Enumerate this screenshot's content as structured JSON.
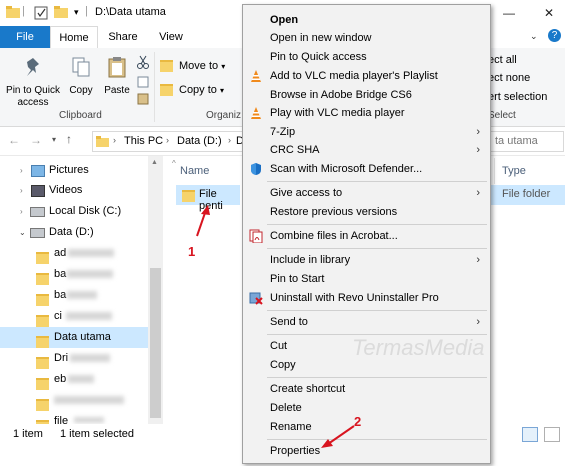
{
  "window": {
    "path": "D:\\Data utama"
  },
  "ribbon": {
    "tabs": [
      {
        "label": "File"
      },
      {
        "label": "Home"
      },
      {
        "label": "Share"
      },
      {
        "label": "View"
      }
    ],
    "pin_label": "Pin to Quick access",
    "copy_label": "Copy",
    "paste_label": "Paste",
    "move_to_label": "Move to",
    "copy_to_label": "Copy to",
    "clipboard_group": "Clipboard",
    "organize_group": "Organiz",
    "select_all": "ect all",
    "select_none": "ect none",
    "invert_selection": "ert selection",
    "select_group": "Select"
  },
  "address": {
    "crumbs": [
      {
        "label": "This PC"
      },
      {
        "label": "Data (D:)"
      },
      {
        "label": "D"
      }
    ],
    "search_placeholder": "ta utama"
  },
  "nav": {
    "items": [
      {
        "label": "Pictures"
      },
      {
        "label": "Videos"
      },
      {
        "label": "Local Disk (C:)"
      },
      {
        "label": "Data (D:)"
      },
      {
        "label": "ad"
      },
      {
        "label": "ba"
      },
      {
        "label": "ba"
      },
      {
        "label": "ci"
      },
      {
        "label": "Data utama"
      },
      {
        "label": "Dri"
      },
      {
        "label": "eb"
      },
      {
        "label": ""
      },
      {
        "label": "file"
      }
    ]
  },
  "columns": {
    "name": "Name",
    "type": "Type"
  },
  "files": [
    {
      "name": "File penti",
      "type": "File folder"
    }
  ],
  "status": {
    "count": "1 item",
    "selected": "1 item selected"
  },
  "context_menu": {
    "items": [
      {
        "label": "Open"
      },
      {
        "label": "Open in new window"
      },
      {
        "label": "Pin to Quick access"
      },
      {
        "label": "Add to VLC media player's Playlist"
      },
      {
        "label": "Browse in Adobe Bridge CS6"
      },
      {
        "label": "Play with VLC media player"
      },
      {
        "label": "7-Zip"
      },
      {
        "label": "CRC SHA"
      },
      {
        "label": "Scan with Microsoft Defender..."
      },
      {
        "label": "Give access to"
      },
      {
        "label": "Restore previous versions"
      },
      {
        "label": "Combine files in Acrobat..."
      },
      {
        "label": "Include in library"
      },
      {
        "label": "Pin to Start"
      },
      {
        "label": "Uninstall with Revo Uninstaller Pro"
      },
      {
        "label": "Send to"
      },
      {
        "label": "Cut"
      },
      {
        "label": "Copy"
      },
      {
        "label": "Create shortcut"
      },
      {
        "label": "Delete"
      },
      {
        "label": "Rename"
      },
      {
        "label": "Properties"
      }
    ]
  },
  "annotations": {
    "marker1": "1",
    "marker2": "2"
  },
  "watermark": "TermasMedia",
  "colors": {
    "accent": "#1979ca",
    "selection": "#cce8ff",
    "marker": "#d8141f"
  }
}
